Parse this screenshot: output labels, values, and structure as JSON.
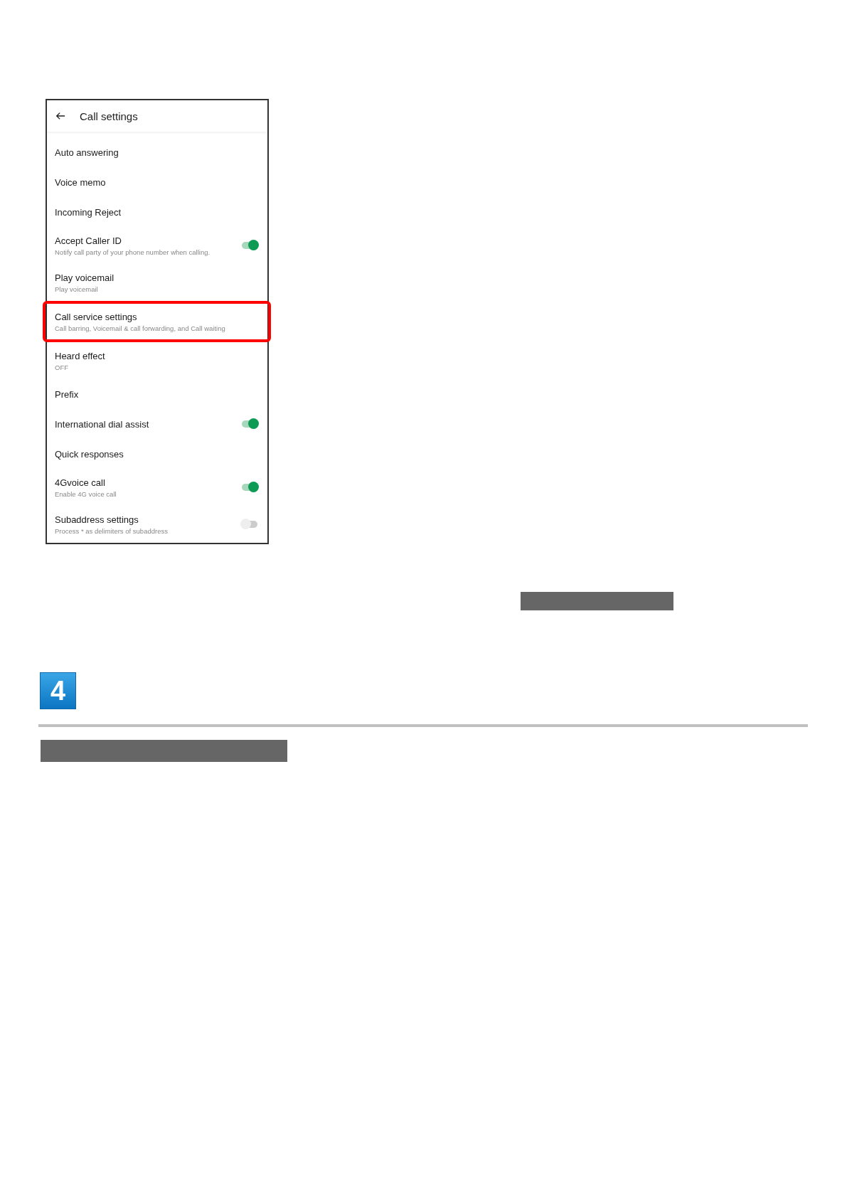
{
  "screen": {
    "title": "Call settings",
    "items": [
      {
        "title": "Auto answering",
        "kind": "plain",
        "highlighted": false
      },
      {
        "title": "Voice memo",
        "kind": "plain",
        "highlighted": false
      },
      {
        "title": "Incoming Reject",
        "kind": "plain",
        "highlighted": false
      },
      {
        "title": "Accept Caller ID",
        "subtitle": "Notify call party of your phone number when calling.",
        "kind": "toggle",
        "on": true,
        "highlighted": false
      },
      {
        "title": "Play voicemail",
        "subtitle": "Play voicemail",
        "kind": "plain",
        "highlighted": false
      },
      {
        "title": "Call service settings",
        "subtitle": "Call barring, Voicemail & call forwarding, and Call waiting",
        "kind": "plain",
        "highlighted": true
      },
      {
        "title": "Heard effect",
        "subtitle": "OFF",
        "kind": "plain",
        "highlighted": false
      },
      {
        "title": "Prefix",
        "kind": "plain",
        "highlighted": false
      },
      {
        "title": "International dial assist",
        "kind": "toggle",
        "on": true,
        "highlighted": false
      },
      {
        "title": "Quick responses",
        "kind": "plain",
        "highlighted": false
      },
      {
        "title": "4Gvoice call",
        "subtitle": "Enable 4G voice call",
        "kind": "toggle",
        "on": true,
        "highlighted": false
      },
      {
        "title": "Subaddress settings",
        "subtitle": "Process * as delimiters of subaddress",
        "kind": "toggle",
        "on": false,
        "highlighted": false
      }
    ]
  },
  "step": {
    "number": "4"
  }
}
